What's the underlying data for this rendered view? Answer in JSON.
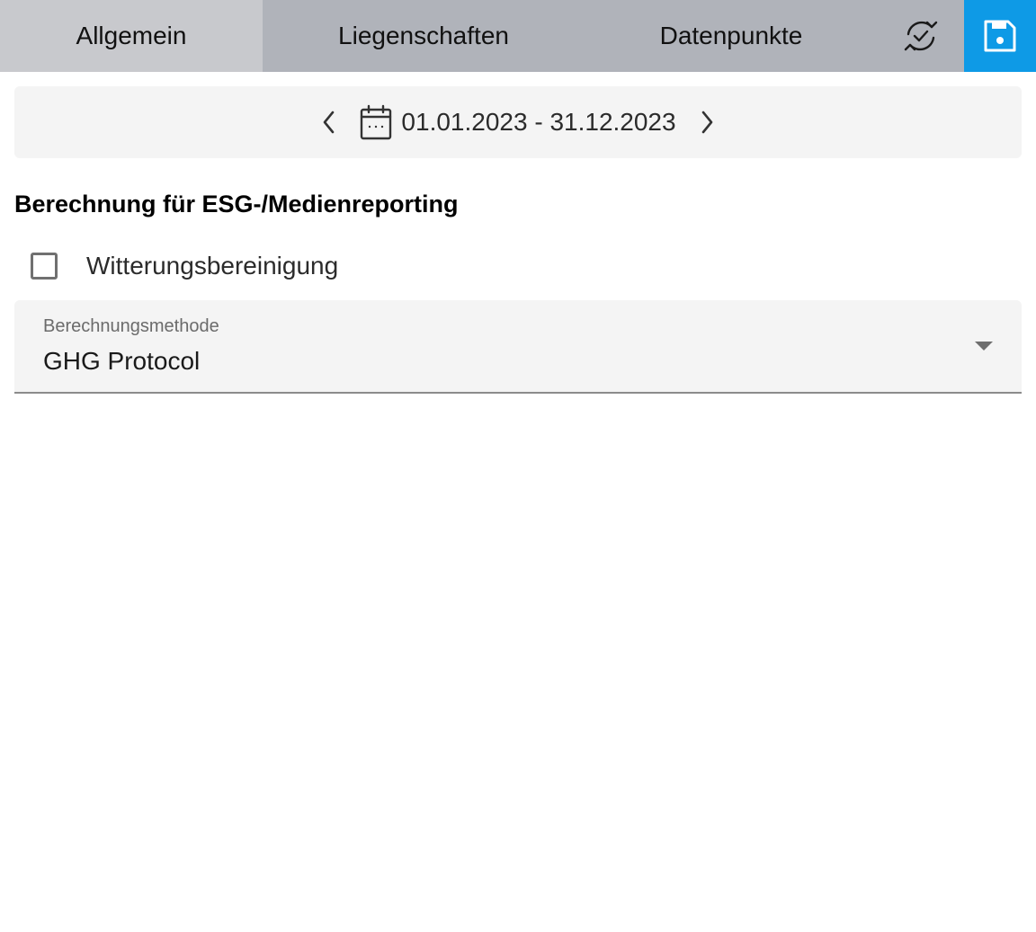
{
  "tabs": [
    {
      "label": "Allgemein",
      "active": true
    },
    {
      "label": "Liegenschaften",
      "active": false
    },
    {
      "label": "Datenpunkte",
      "active": false
    }
  ],
  "toolbar": {
    "sync_icon": "sync-check-icon",
    "save_icon": "floppy-disk-icon",
    "save_color": "#0e9ae6"
  },
  "date_range": {
    "text": "01.01.2023 - 31.12.2023",
    "prev_icon": "chevron-left-icon",
    "next_icon": "chevron-right-icon",
    "calendar_icon": "calendar-icon"
  },
  "section": {
    "title": "Berechnung für ESG-/Medienreporting"
  },
  "weather_adjustment": {
    "label": "Witterungsbereinigung",
    "checked": false
  },
  "calculation_method": {
    "label": "Berechnungsmethode",
    "value": "GHG Protocol"
  }
}
